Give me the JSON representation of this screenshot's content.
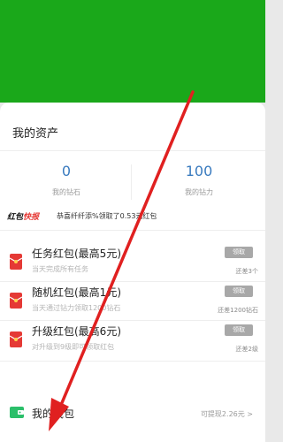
{
  "assets": {
    "title": "我的资产",
    "diamonds": {
      "value": "0",
      "label": "我的钻石"
    },
    "power": {
      "value": "100",
      "label": "我的钻力"
    }
  },
  "news": {
    "badge_part1": "红包",
    "badge_part2": "快报",
    "text": "恭喜纤纤添%领取了0.53元红包"
  },
  "tasks": [
    {
      "title": "任务红包(最高5元)",
      "subtitle": "当天完成所有任务",
      "button": "领取",
      "status": "还差3个"
    },
    {
      "title": "随机红包(最高1元)",
      "subtitle": "当天通过钻力领取1200钻石",
      "button": "领取",
      "status": "还差1200钻石"
    },
    {
      "title": "升级红包(最高6元)",
      "subtitle": "对升级到9级即可领取红包",
      "button": "领取",
      "status": "还差2级"
    }
  ],
  "wallet": {
    "title": "我的钱包",
    "info": "可提现2.26元 >"
  },
  "colors": {
    "header_green": "#1aa81a",
    "accent_blue": "#3a7bbf",
    "icon_red": "#e53935",
    "arrow_red": "#e02020",
    "wallet_green": "#2bbf6a"
  },
  "icons": {
    "task": "red-envelope-icon",
    "wallet": "wallet-icon"
  }
}
